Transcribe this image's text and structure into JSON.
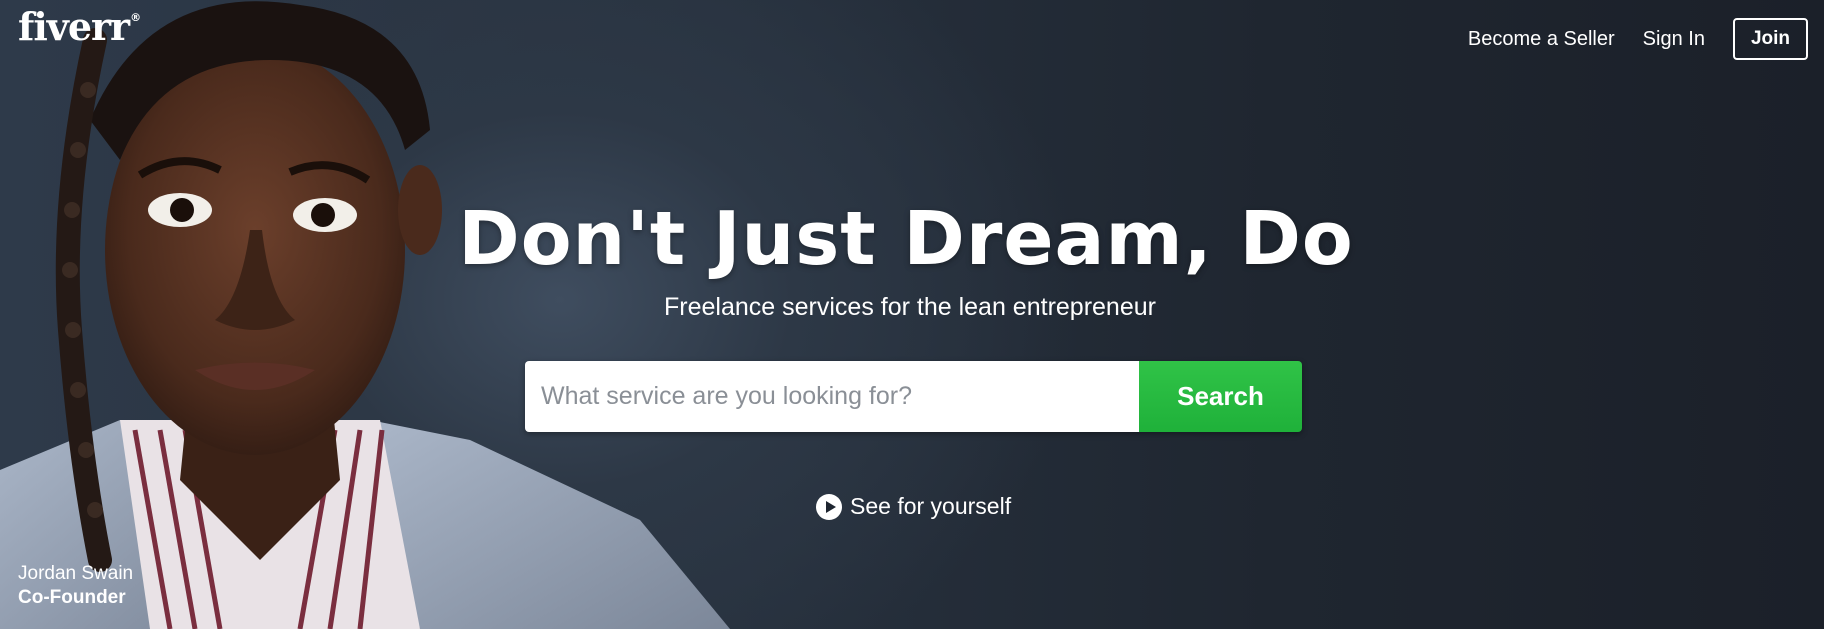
{
  "brand": {
    "logo_text": "fiverr",
    "logo_mark": "®"
  },
  "nav": {
    "become_seller": "Become a Seller",
    "sign_in": "Sign In",
    "join": "Join"
  },
  "hero": {
    "headline": "Don't Just Dream, Do",
    "subheadline": "Freelance services for the lean entrepreneur",
    "search": {
      "placeholder": "What service are you looking for?",
      "value": "",
      "button_label": "Search"
    },
    "video_link": "See for yourself",
    "person": {
      "name": "Jordan Swain",
      "role": "Co-Founder"
    }
  },
  "colors": {
    "background": "#1e2530",
    "search_button": "#1fb13a",
    "text": "#ffffff"
  },
  "icons": {
    "video_link": "play-circle-icon"
  }
}
